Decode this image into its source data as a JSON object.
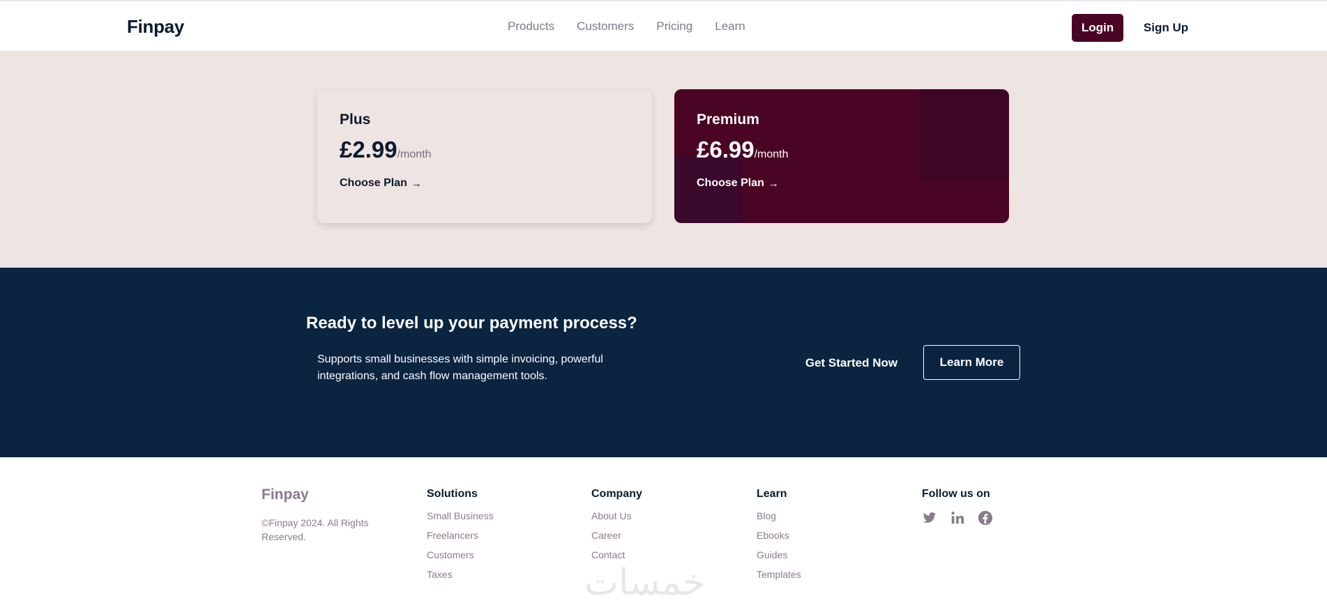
{
  "header": {
    "logo": "Finpay",
    "nav": [
      "Products",
      "Customers",
      "Pricing",
      "Learn"
    ],
    "login_label": "Login",
    "signup_label": "Sign Up"
  },
  "pricing": {
    "plans": [
      {
        "name": "Plus",
        "price": "£2.99",
        "period": "/month",
        "cta": "Choose Plan"
      },
      {
        "name": "Premium",
        "price": "£6.99",
        "period": "/month",
        "cta": "Choose Plan"
      }
    ]
  },
  "cta": {
    "title": "Ready to level up your payment process?",
    "text": "Supports small businesses with simple invoicing, powerful integrations, and cash flow management tools.",
    "start_label": "Get Started Now",
    "learn_label": "Learn More"
  },
  "footer": {
    "logo": "Finpay",
    "copyright": "©Finpay 2024. All Rights Reserved.",
    "columns": [
      {
        "title": "Solutions",
        "links": [
          "Small Business",
          "Freelancers",
          "Customers",
          "Taxes"
        ]
      },
      {
        "title": "Company",
        "links": [
          "About Us",
          "Career",
          "Contact"
        ]
      },
      {
        "title": "Learn",
        "links": [
          "Blog",
          "Ebooks",
          "Guides",
          "Templates"
        ]
      }
    ],
    "follow_title": "Follow us on",
    "social_icons": [
      "twitter-icon",
      "linkedin-icon",
      "facebook-icon"
    ],
    "watermark": "خمسات"
  },
  "colors": {
    "brand": "#4a0424",
    "navy": "#0b2440",
    "pricing_bg": "#eee4e1",
    "muted": "#8a7a8f"
  }
}
